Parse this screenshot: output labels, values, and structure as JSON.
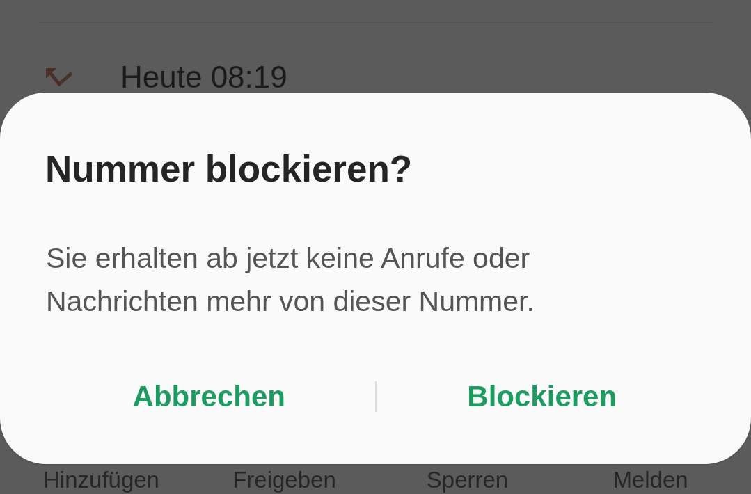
{
  "call_log": {
    "entry": {
      "time": "Heute 08:19"
    }
  },
  "action_bar": {
    "items": [
      {
        "label": "Hinzufügen"
      },
      {
        "label": "Freigeben"
      },
      {
        "label": "Sperren"
      },
      {
        "label": "Melden"
      }
    ]
  },
  "dialog": {
    "title": "Nummer blockieren?",
    "message": "Sie erhalten ab jetzt keine Anrufe oder Nachrichten mehr von dieser Nummer.",
    "buttons": [
      {
        "label": "Abbrechen"
      },
      {
        "label": "Blockieren"
      }
    ]
  }
}
